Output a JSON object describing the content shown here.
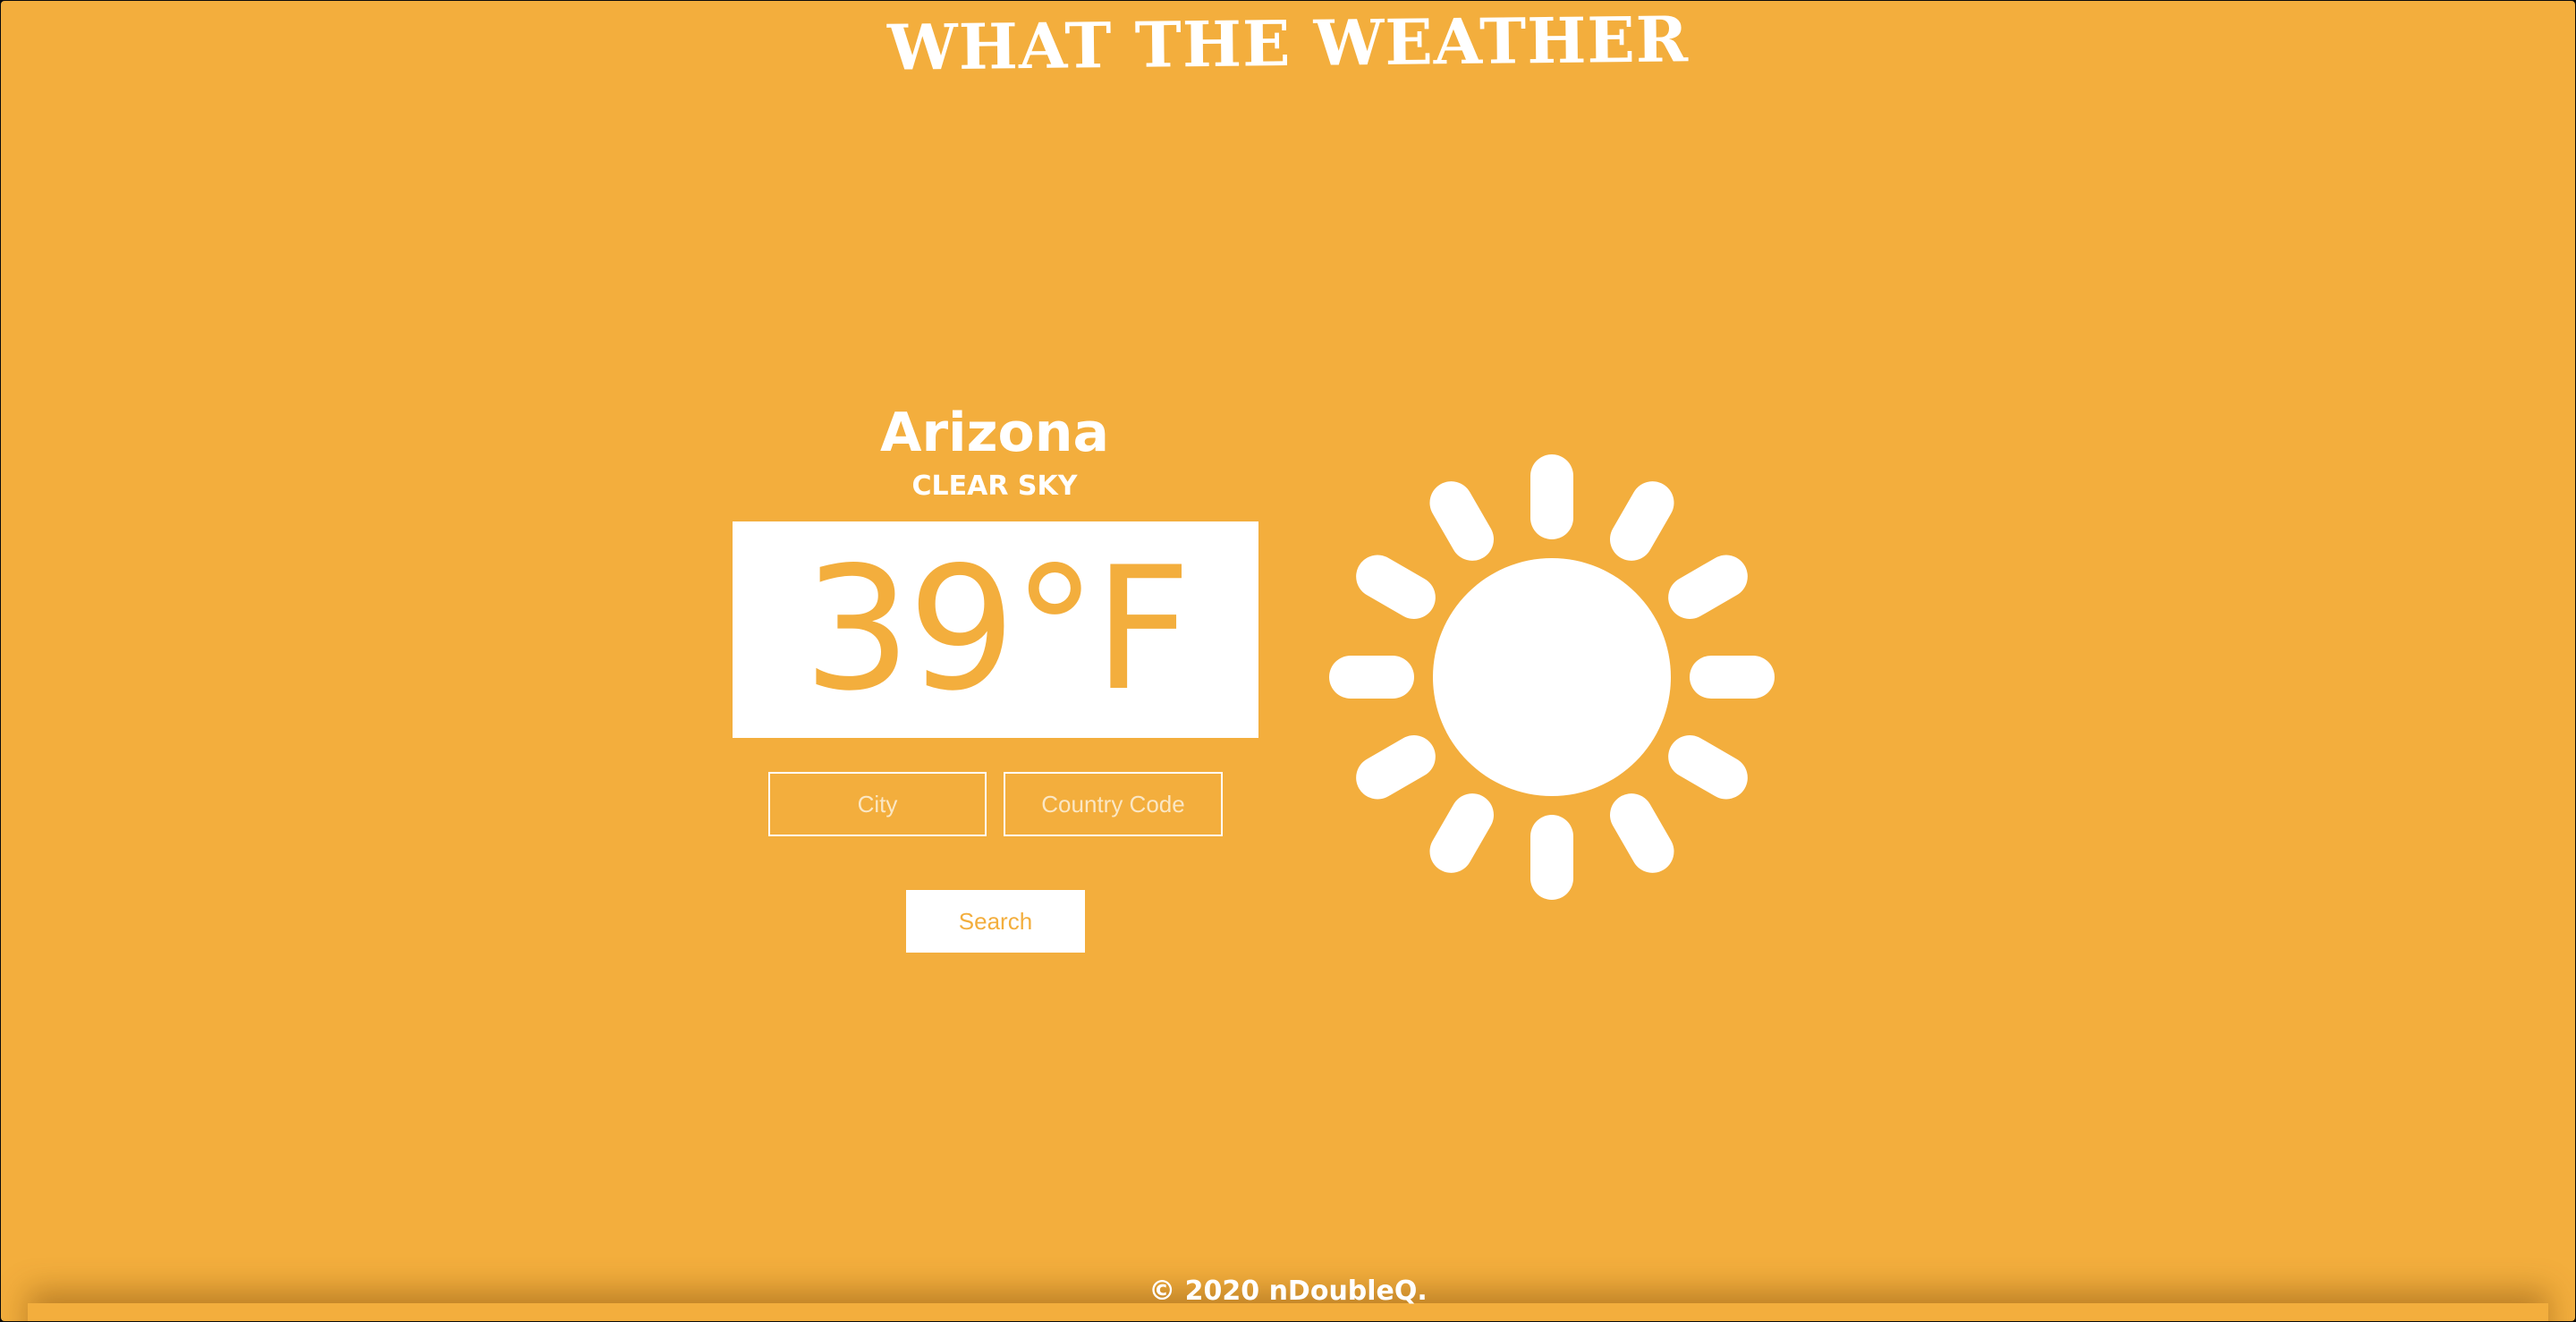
{
  "app": {
    "title": "WHAT THE WEATHER"
  },
  "weather": {
    "location": "Arizona",
    "condition": "CLEAR SKY",
    "temperature": "39°F",
    "icon": "sun-icon"
  },
  "search": {
    "city_placeholder": "City",
    "country_placeholder": "Country Code",
    "button_label": "Search"
  },
  "footer": {
    "text": "© 2020 nDoubleQ."
  },
  "colors": {
    "background": "#f3ae3d",
    "foreground": "#ffffff"
  }
}
